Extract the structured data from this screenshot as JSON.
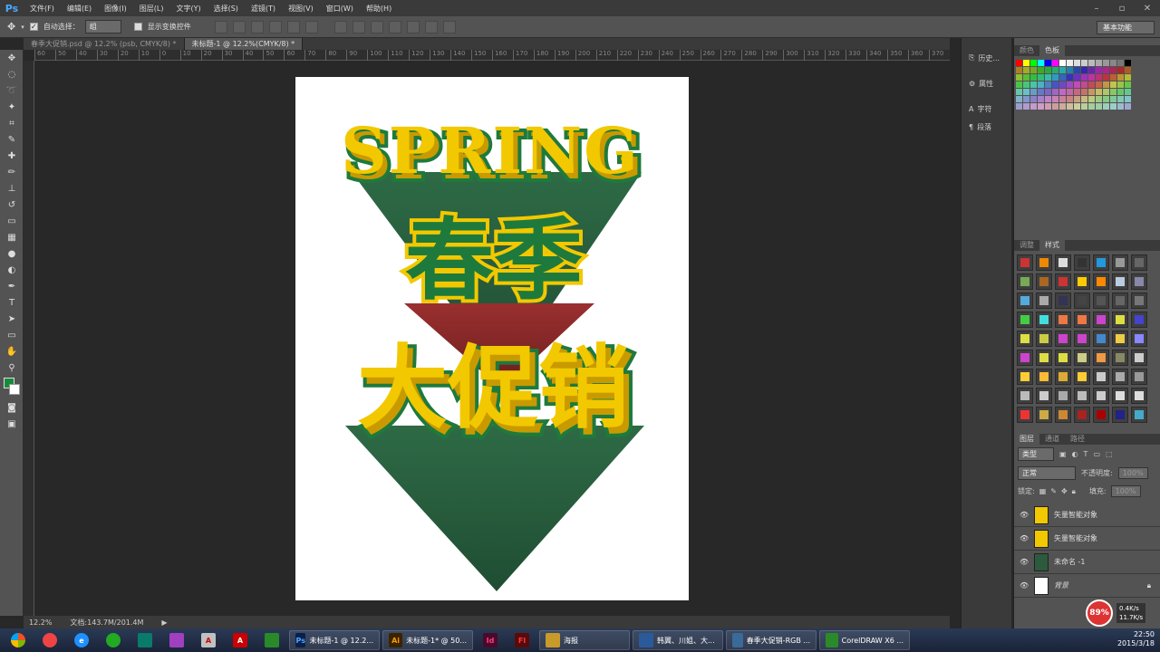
{
  "app": {
    "logo": "Ps"
  },
  "menu": [
    "文件(F)",
    "编辑(E)",
    "图像(I)",
    "图层(L)",
    "文字(Y)",
    "选择(S)",
    "滤镜(T)",
    "视图(V)",
    "窗口(W)",
    "帮助(H)"
  ],
  "options": {
    "auto_select_label": "自动选择：",
    "auto_select_value": "组",
    "show_transform_label": "显示变换控件",
    "workspace": "基本功能"
  },
  "tabs": [
    {
      "label": "春季大促销.psd @ 12.2% (psb, CMYK/8) *"
    },
    {
      "label": "未标题-1 @ 12.2%(CMYK/8) *"
    }
  ],
  "ruler": [
    "60",
    "50",
    "40",
    "30",
    "20",
    "10",
    "0",
    "10",
    "20",
    "30",
    "40",
    "50",
    "60",
    "70",
    "80",
    "90",
    "100",
    "110",
    "120",
    "130",
    "140",
    "150",
    "160",
    "170",
    "180",
    "190",
    "200",
    "210",
    "220",
    "230",
    "240",
    "250",
    "260",
    "270",
    "280",
    "290",
    "300",
    "310",
    "320",
    "330",
    "340",
    "350",
    "360",
    "370"
  ],
  "artwork": {
    "line1": "SPRING",
    "line2": "春季",
    "line3": "大促销",
    "colors": {
      "yellow": "#f2c800",
      "green": "#1e7a3c",
      "dark_green": "#2c5a3c",
      "red": "#8a2a2a"
    }
  },
  "status": {
    "zoom": "12.2%",
    "doc": "文档:143.7M/201.4M"
  },
  "mid_panels": [
    {
      "icon": "history-icon",
      "label": "历史..."
    },
    {
      "icon": "properties-icon",
      "label": "属性"
    },
    {
      "icon": "character-icon",
      "label": "字符"
    },
    {
      "icon": "paragraph-icon",
      "label": "段落"
    }
  ],
  "panels": {
    "color_tabs": [
      "颜色",
      "色板"
    ],
    "styles_tabs": [
      "调整",
      "样式"
    ],
    "layers_tabs": [
      "图层",
      "通道",
      "路径"
    ],
    "layer_filter": "类型",
    "blend_mode": "正常",
    "opacity_label": "不透明度:",
    "opacity_value": "100%",
    "lock_label": "锁定:",
    "fill_label": "填充:",
    "fill_value": "100%"
  },
  "layers": [
    {
      "name": "矢量智能对象"
    },
    {
      "name": "矢量智能对象"
    },
    {
      "name": "未命名 -1"
    },
    {
      "name": "背景"
    }
  ],
  "taskbar": {
    "buttons": [
      {
        "label": "未标题-1 @ 12.2...",
        "icon": "Ps",
        "color": "#0b1f4a"
      },
      {
        "label": "未标题-1* @ 50...",
        "icon": "Ai",
        "color": "#3a2400"
      },
      {
        "label": "海报",
        "icon": "folder",
        "color": "#c89a2a"
      },
      {
        "label": "韩翼、川姐、大...",
        "icon": "chat",
        "color": "#2a5a9a"
      },
      {
        "label": "春季大促销-RGB ...",
        "icon": "img",
        "color": "#3a6a9a"
      },
      {
        "label": "CorelDRAW X6 ...",
        "icon": "cdr",
        "color": "#2a8a2a"
      }
    ],
    "net_percent": "89%",
    "net_up": "0.4K/s",
    "net_down": "11.7K/s",
    "time": "22:50",
    "date": "2015/3/18"
  }
}
